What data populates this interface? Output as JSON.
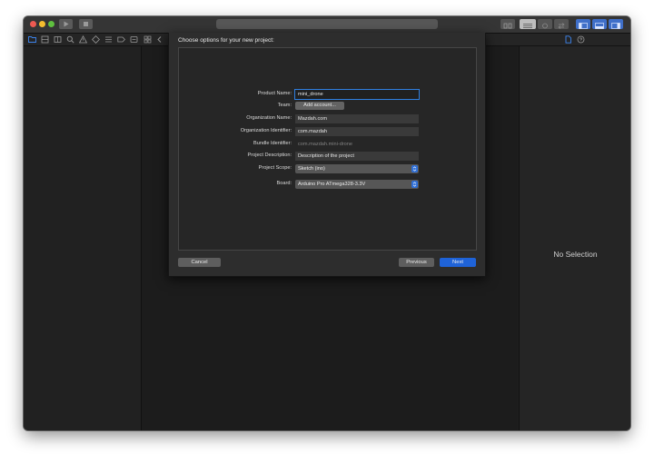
{
  "titlebar": {
    "traffic_lights": {
      "close": "#ee5a52",
      "minimize": "#f5bd2f",
      "zoom": "#5fc03f"
    },
    "run_icon": "play-icon",
    "stop_icon": "stop-icon"
  },
  "navigator_icons": [
    "folder-icon",
    "source-control-icon",
    "symbol-icon",
    "find-icon",
    "issue-icon",
    "test-icon",
    "debug-icon",
    "breakpoint-icon",
    "report-icon"
  ],
  "dialog": {
    "title": "Choose options for your new project:",
    "fields": {
      "product_name": {
        "label": "Product Name:",
        "value": "mini_drone"
      },
      "team": {
        "label": "Team:",
        "button": "Add account..."
      },
      "organization_name": {
        "label": "Organization Name:",
        "value": "Mazdah.com"
      },
      "organization_identifier": {
        "label": "Organization Identifier:",
        "value": "com.mazdah"
      },
      "bundle_identifier": {
        "label": "Bundle Identifier:",
        "value": "com.mazdah.mini-drone"
      },
      "project_description": {
        "label": "Project Description:",
        "value": "Description of the project"
      },
      "project_scope": {
        "label": "Project Scope:",
        "value": "Sketch (ino)"
      },
      "board": {
        "label": "Board:",
        "value": "Arduino Pro ATmega328-3.3V"
      }
    },
    "buttons": {
      "cancel": "Cancel",
      "previous": "Previous",
      "next": "Next"
    },
    "accent_color": "#1f63d8"
  },
  "inspector": {
    "empty_text": "No Selection",
    "icons": [
      "file-inspector-icon",
      "help-inspector-icon"
    ]
  }
}
